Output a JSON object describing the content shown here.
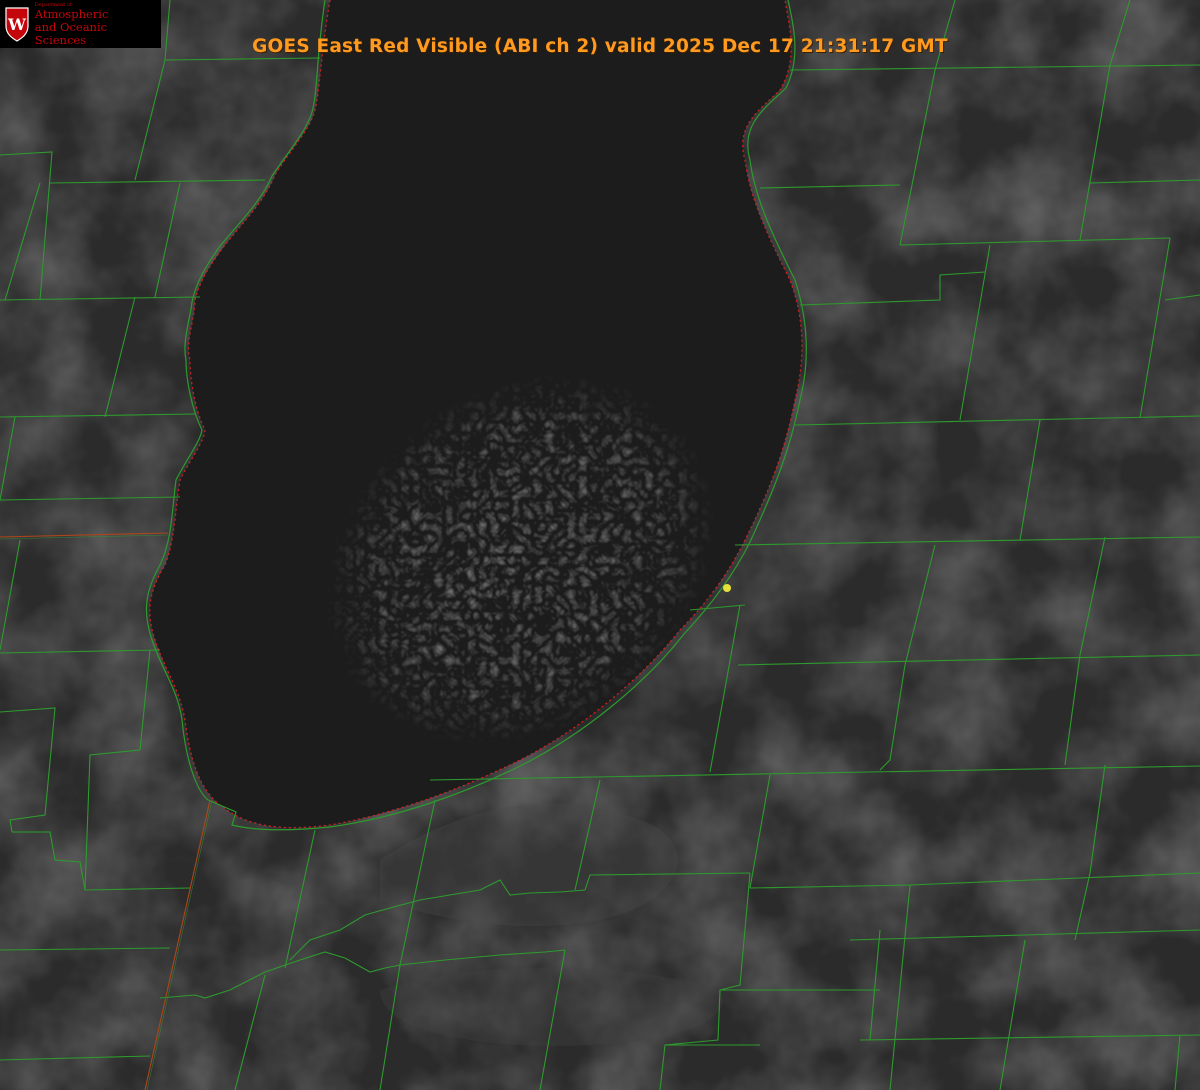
{
  "title": "GOES East Red Visible (ABI ch 2) valid 2025 Dec 17 21:31:17 GMT",
  "logo": {
    "dept_line": "Department of",
    "name_line1": "Atmospheric",
    "name_line2": "and Oceanic Sciences",
    "crest_letter": "W",
    "icon": "uw-crest-icon"
  },
  "colors": {
    "land": "#2d2d2d",
    "lake": "#1c1c1c",
    "county_lines": "#2e9a2e",
    "state_border": "#b0451a",
    "coastline_dots": "#d02020",
    "marker": "#e8e03a",
    "title": "#ff9a1f"
  },
  "features": {
    "lake": "lake-michigan",
    "cloud_band": "lake-effect-cloud-field",
    "marker": "station-marker"
  }
}
